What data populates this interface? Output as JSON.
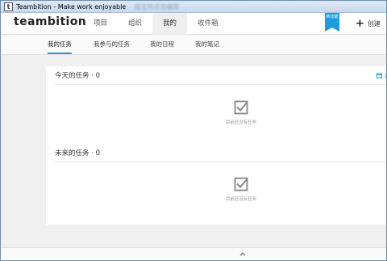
{
  "window": {
    "app_icon": "t",
    "title": "Teambition - Make work enjoyable",
    "blurred_text": "成支持点击编辑"
  },
  "header": {
    "logo": "teambition",
    "nav": [
      "项目",
      "组织",
      "我的",
      "收件箱"
    ],
    "active_nav": "我的",
    "ribbon": "新功能",
    "create_label": "创建"
  },
  "subnav": {
    "tabs": [
      "我的任务",
      "我参与的任务",
      "我的日程",
      "我的笔记"
    ],
    "active": "我的任务"
  },
  "sections": [
    {
      "title": "今天的任务 · 0",
      "empty_text": "目前还没有任务"
    },
    {
      "title": "未来的任务 · 0",
      "empty_text": "目前还没有任务"
    }
  ],
  "calendar_link": "订",
  "icons": {
    "check": "checkbox-check-icon",
    "calendar": "calendar-icon",
    "plus": "plus-icon",
    "up": "chevron-up-icon"
  },
  "colors": {
    "accent": "#1f9be0"
  }
}
